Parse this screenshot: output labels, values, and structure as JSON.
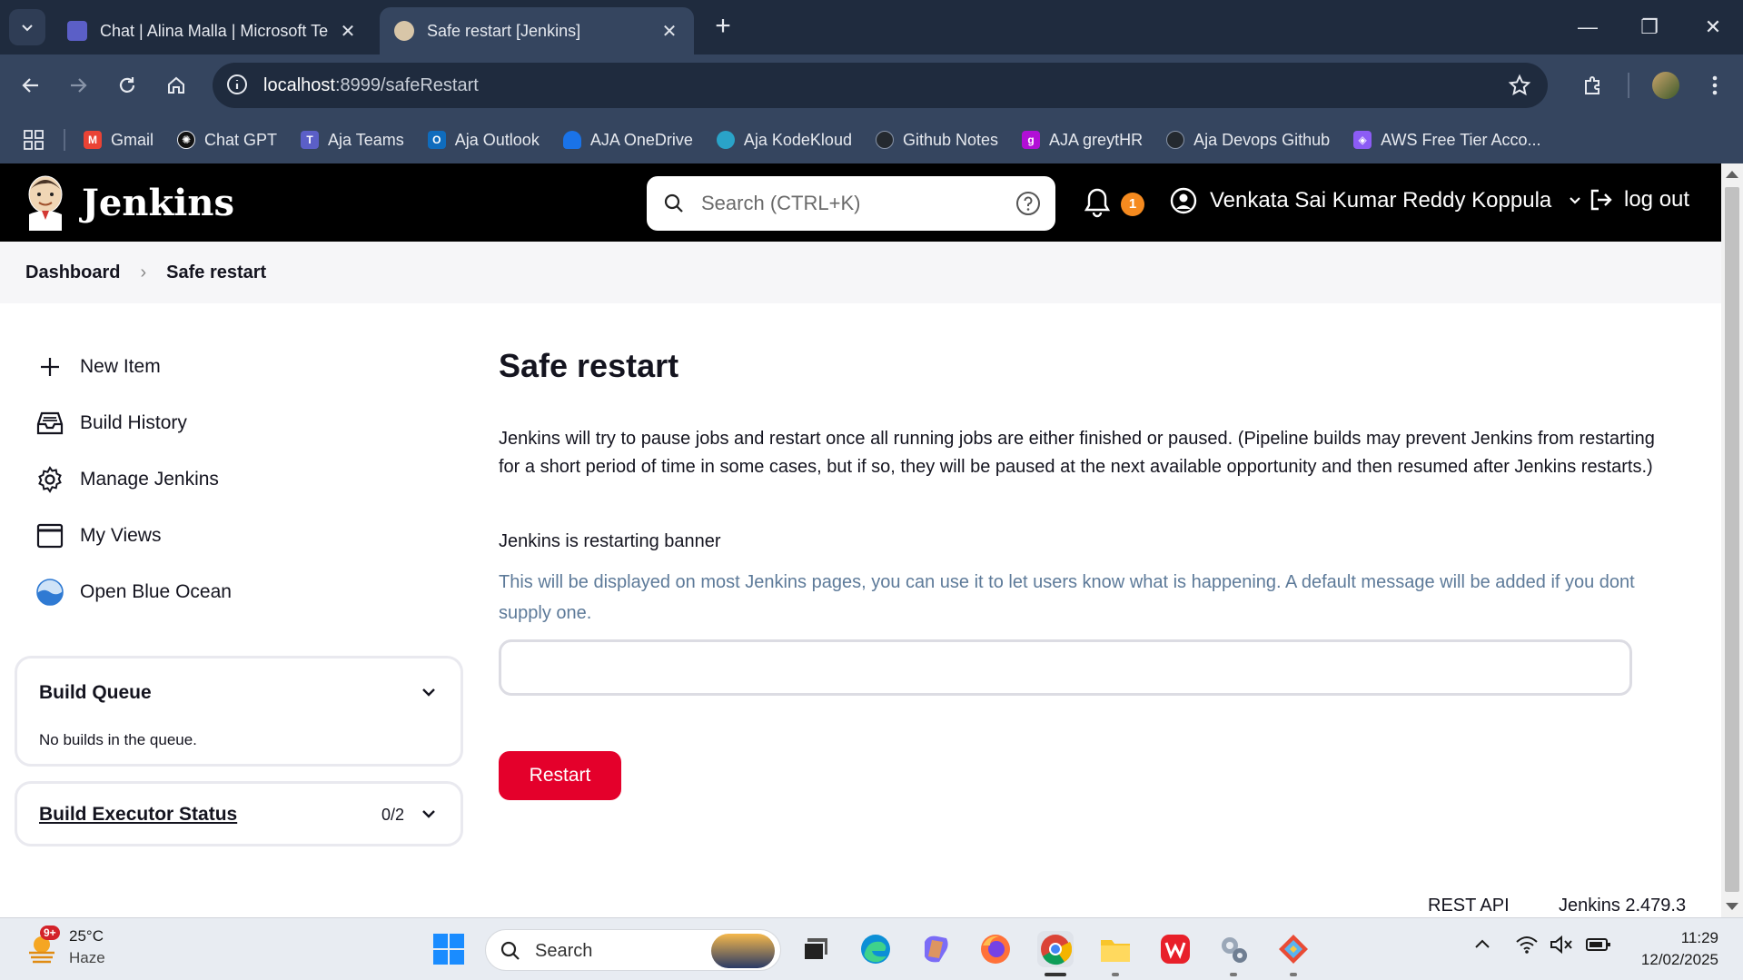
{
  "browser": {
    "tabs": [
      {
        "title": "Chat | Alina Malla | Microsoft Te",
        "active": false,
        "icon": "teams-icon"
      },
      {
        "title": "Safe restart [Jenkins]",
        "active": true,
        "icon": "jenkins-icon"
      }
    ],
    "url_host": "localhost",
    "url_rest": ":8999/safeRestart",
    "bookmarks": [
      {
        "label": "Gmail",
        "icon": "gmail-icon",
        "color": "#ea4335"
      },
      {
        "label": "Chat GPT",
        "icon": "chatgpt-icon",
        "color": "#111111"
      },
      {
        "label": "Aja Teams",
        "icon": "teams-icon",
        "color": "#5b5fc7"
      },
      {
        "label": "Aja Outlook",
        "icon": "outlook-icon",
        "color": "#0f6cbd"
      },
      {
        "label": "AJA OneDrive",
        "icon": "onedrive-icon",
        "color": "#1a73e8"
      },
      {
        "label": "Aja KodeKloud",
        "icon": "kodekloud-icon",
        "color": "#2aa3c8"
      },
      {
        "label": "Github Notes",
        "icon": "github-icon",
        "color": "#24292f"
      },
      {
        "label": "AJA greytHR",
        "icon": "greythr-icon",
        "color": "#b10fd6"
      },
      {
        "label": "Aja Devops Github",
        "icon": "github-icon",
        "color": "#24292f"
      },
      {
        "label": "AWS Free Tier Acco...",
        "icon": "aws-icon",
        "color": "#8c5cf5"
      }
    ]
  },
  "jenkins": {
    "brand": "Jenkins",
    "search_placeholder": "Search (CTRL+K)",
    "notifications_count": "1",
    "user_name": "Venkata Sai Kumar Reddy Koppula",
    "logout_label": "log out"
  },
  "breadcrumb": {
    "items": [
      "Dashboard",
      "Safe restart"
    ]
  },
  "sidepanel": {
    "tasks": [
      {
        "label": "New Item",
        "icon": "plus-icon"
      },
      {
        "label": "Build History",
        "icon": "inbox-icon"
      },
      {
        "label": "Manage Jenkins",
        "icon": "gear-icon"
      },
      {
        "label": "My Views",
        "icon": "window-icon"
      },
      {
        "label": "Open Blue Ocean",
        "icon": "blue-ocean-icon"
      }
    ],
    "build_queue": {
      "title": "Build Queue",
      "empty_text": "No builds in the queue."
    },
    "executor_status": {
      "title": "Build Executor Status",
      "count": "0/2"
    }
  },
  "main": {
    "title": "Safe restart",
    "description": "Jenkins will try to pause jobs and restart once all running jobs are either finished or paused. (Pipeline builds may prevent Jenkins from restarting for a short period of time in some cases, but if so, they will be paused at the next available opportunity and then resumed after Jenkins restarts.)",
    "banner_label": "Jenkins is restarting banner",
    "banner_help": "This will be displayed on most Jenkins pages, you can use it to let users know what is happening. A default message will be added if you dont supply one.",
    "banner_value": "",
    "restart_label": "Restart",
    "accent_color": "#e4002b"
  },
  "footer": {
    "rest_api": "REST API",
    "version": "Jenkins 2.479.3"
  },
  "taskbar": {
    "weather_temp": "25°C",
    "weather_desc": "Haze",
    "weather_badge": "9+",
    "search_label": "Search",
    "time": "11:29",
    "date": "12/02/2025"
  }
}
